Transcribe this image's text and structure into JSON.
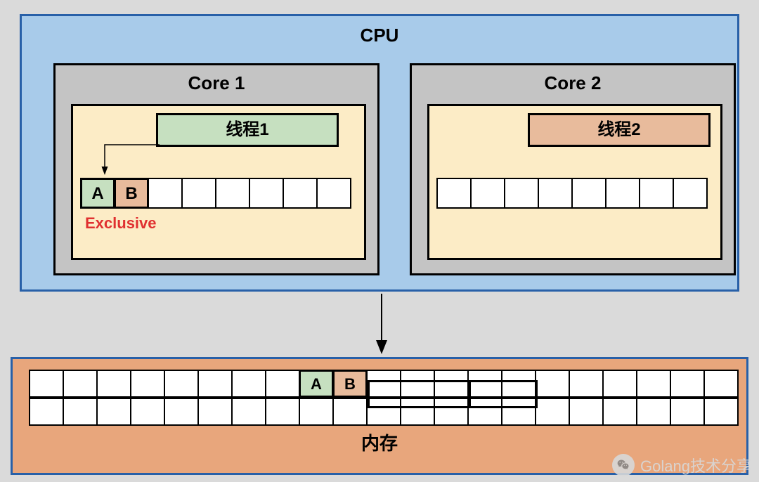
{
  "cpu": {
    "title": "CPU"
  },
  "core1": {
    "title": "Core 1",
    "thread": "线程1",
    "cache": [
      "A",
      "B",
      "",
      "",
      "",
      "",
      "",
      ""
    ],
    "state": "Exclusive"
  },
  "core2": {
    "title": "Core 2",
    "thread": "线程2",
    "cache": [
      "",
      "",
      "",
      "",
      "",
      "",
      "",
      ""
    ]
  },
  "memory": {
    "label": "内存",
    "row1": [
      "",
      "",
      "",
      "",
      "",
      "",
      "",
      "",
      "A",
      "B",
      "",
      "",
      "",
      "",
      "",
      "",
      "",
      "",
      "",
      "",
      ""
    ],
    "row2": [
      "",
      "",
      "",
      "",
      "",
      "",
      "",
      "",
      "",
      "",
      "",
      "",
      "",
      "",
      "",
      "",
      "",
      "",
      "",
      "",
      ""
    ]
  },
  "watermark": "Golang技术分享"
}
